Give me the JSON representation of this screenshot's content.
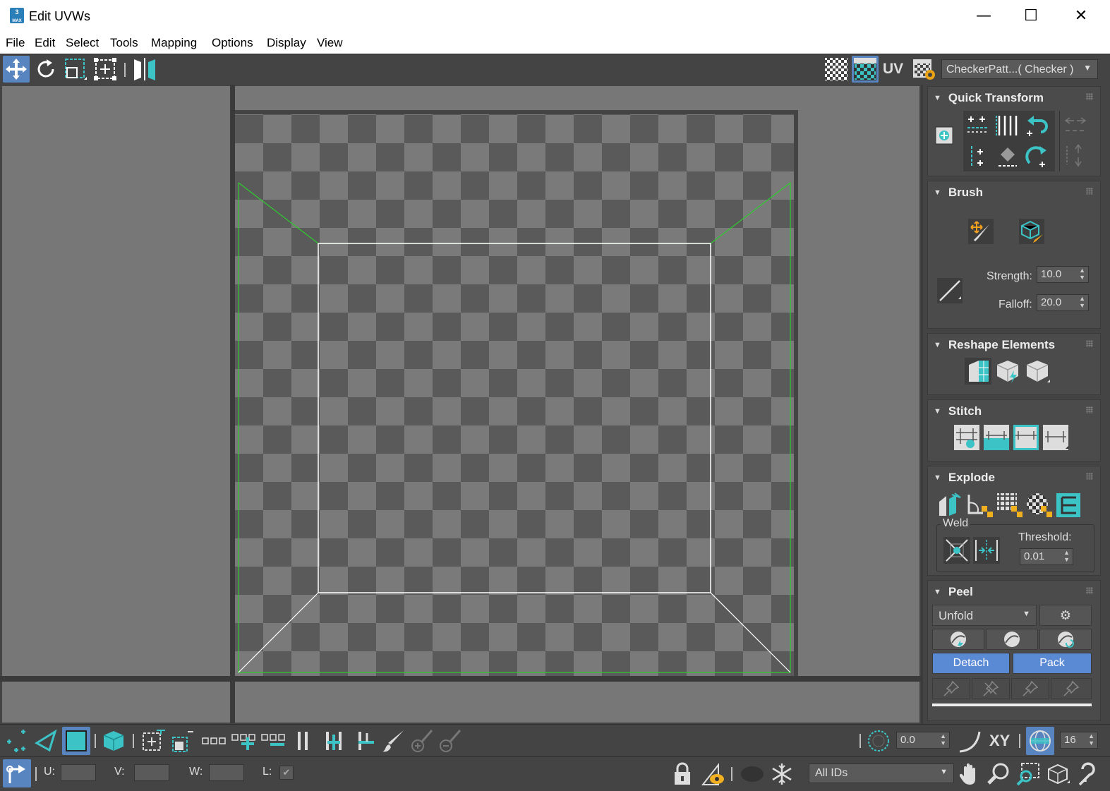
{
  "window": {
    "title": "Edit UVWs",
    "minimize": "—",
    "maximize": "☐",
    "close": "✕",
    "app_badge": "3\nMAX"
  },
  "menu": [
    "File",
    "Edit",
    "Select",
    "Tools",
    "Mapping",
    "Options",
    "Display",
    "View"
  ],
  "toolbar": {
    "uv_label": "UV",
    "texture_dropdown": "CheckerPatt...( Checker )"
  },
  "panels": {
    "quick_transform": {
      "title": "Quick Transform"
    },
    "brush": {
      "title": "Brush",
      "strength_label": "Strength:",
      "strength_value": "10.0",
      "falloff_label": "Falloff:",
      "falloff_value": "20.0"
    },
    "reshape": {
      "title": "Reshape Elements"
    },
    "stitch": {
      "title": "Stitch"
    },
    "explode": {
      "title": "Explode",
      "weld_label": "Weld",
      "threshold_label": "Threshold:",
      "threshold_value": "0.01"
    },
    "peel": {
      "title": "Peel",
      "mode": "Unfold",
      "detach": "Detach",
      "pack": "Pack"
    }
  },
  "bottom": {
    "soft_value": "0.0",
    "xy_label": "XY",
    "grid_value": "16",
    "u_label": "U:",
    "v_label": "V:",
    "w_label": "W:",
    "l_label": "L:",
    "l_checked": "✔",
    "ids_dropdown": "All IDs"
  },
  "colors": {
    "accent": "#5885c0",
    "teal": "#3cc3c6",
    "edge_green": "#2ecc2e",
    "edge_white": "#ffffff",
    "checker_light": "#7a7a7a",
    "checker_dark": "#5a5a5a"
  }
}
